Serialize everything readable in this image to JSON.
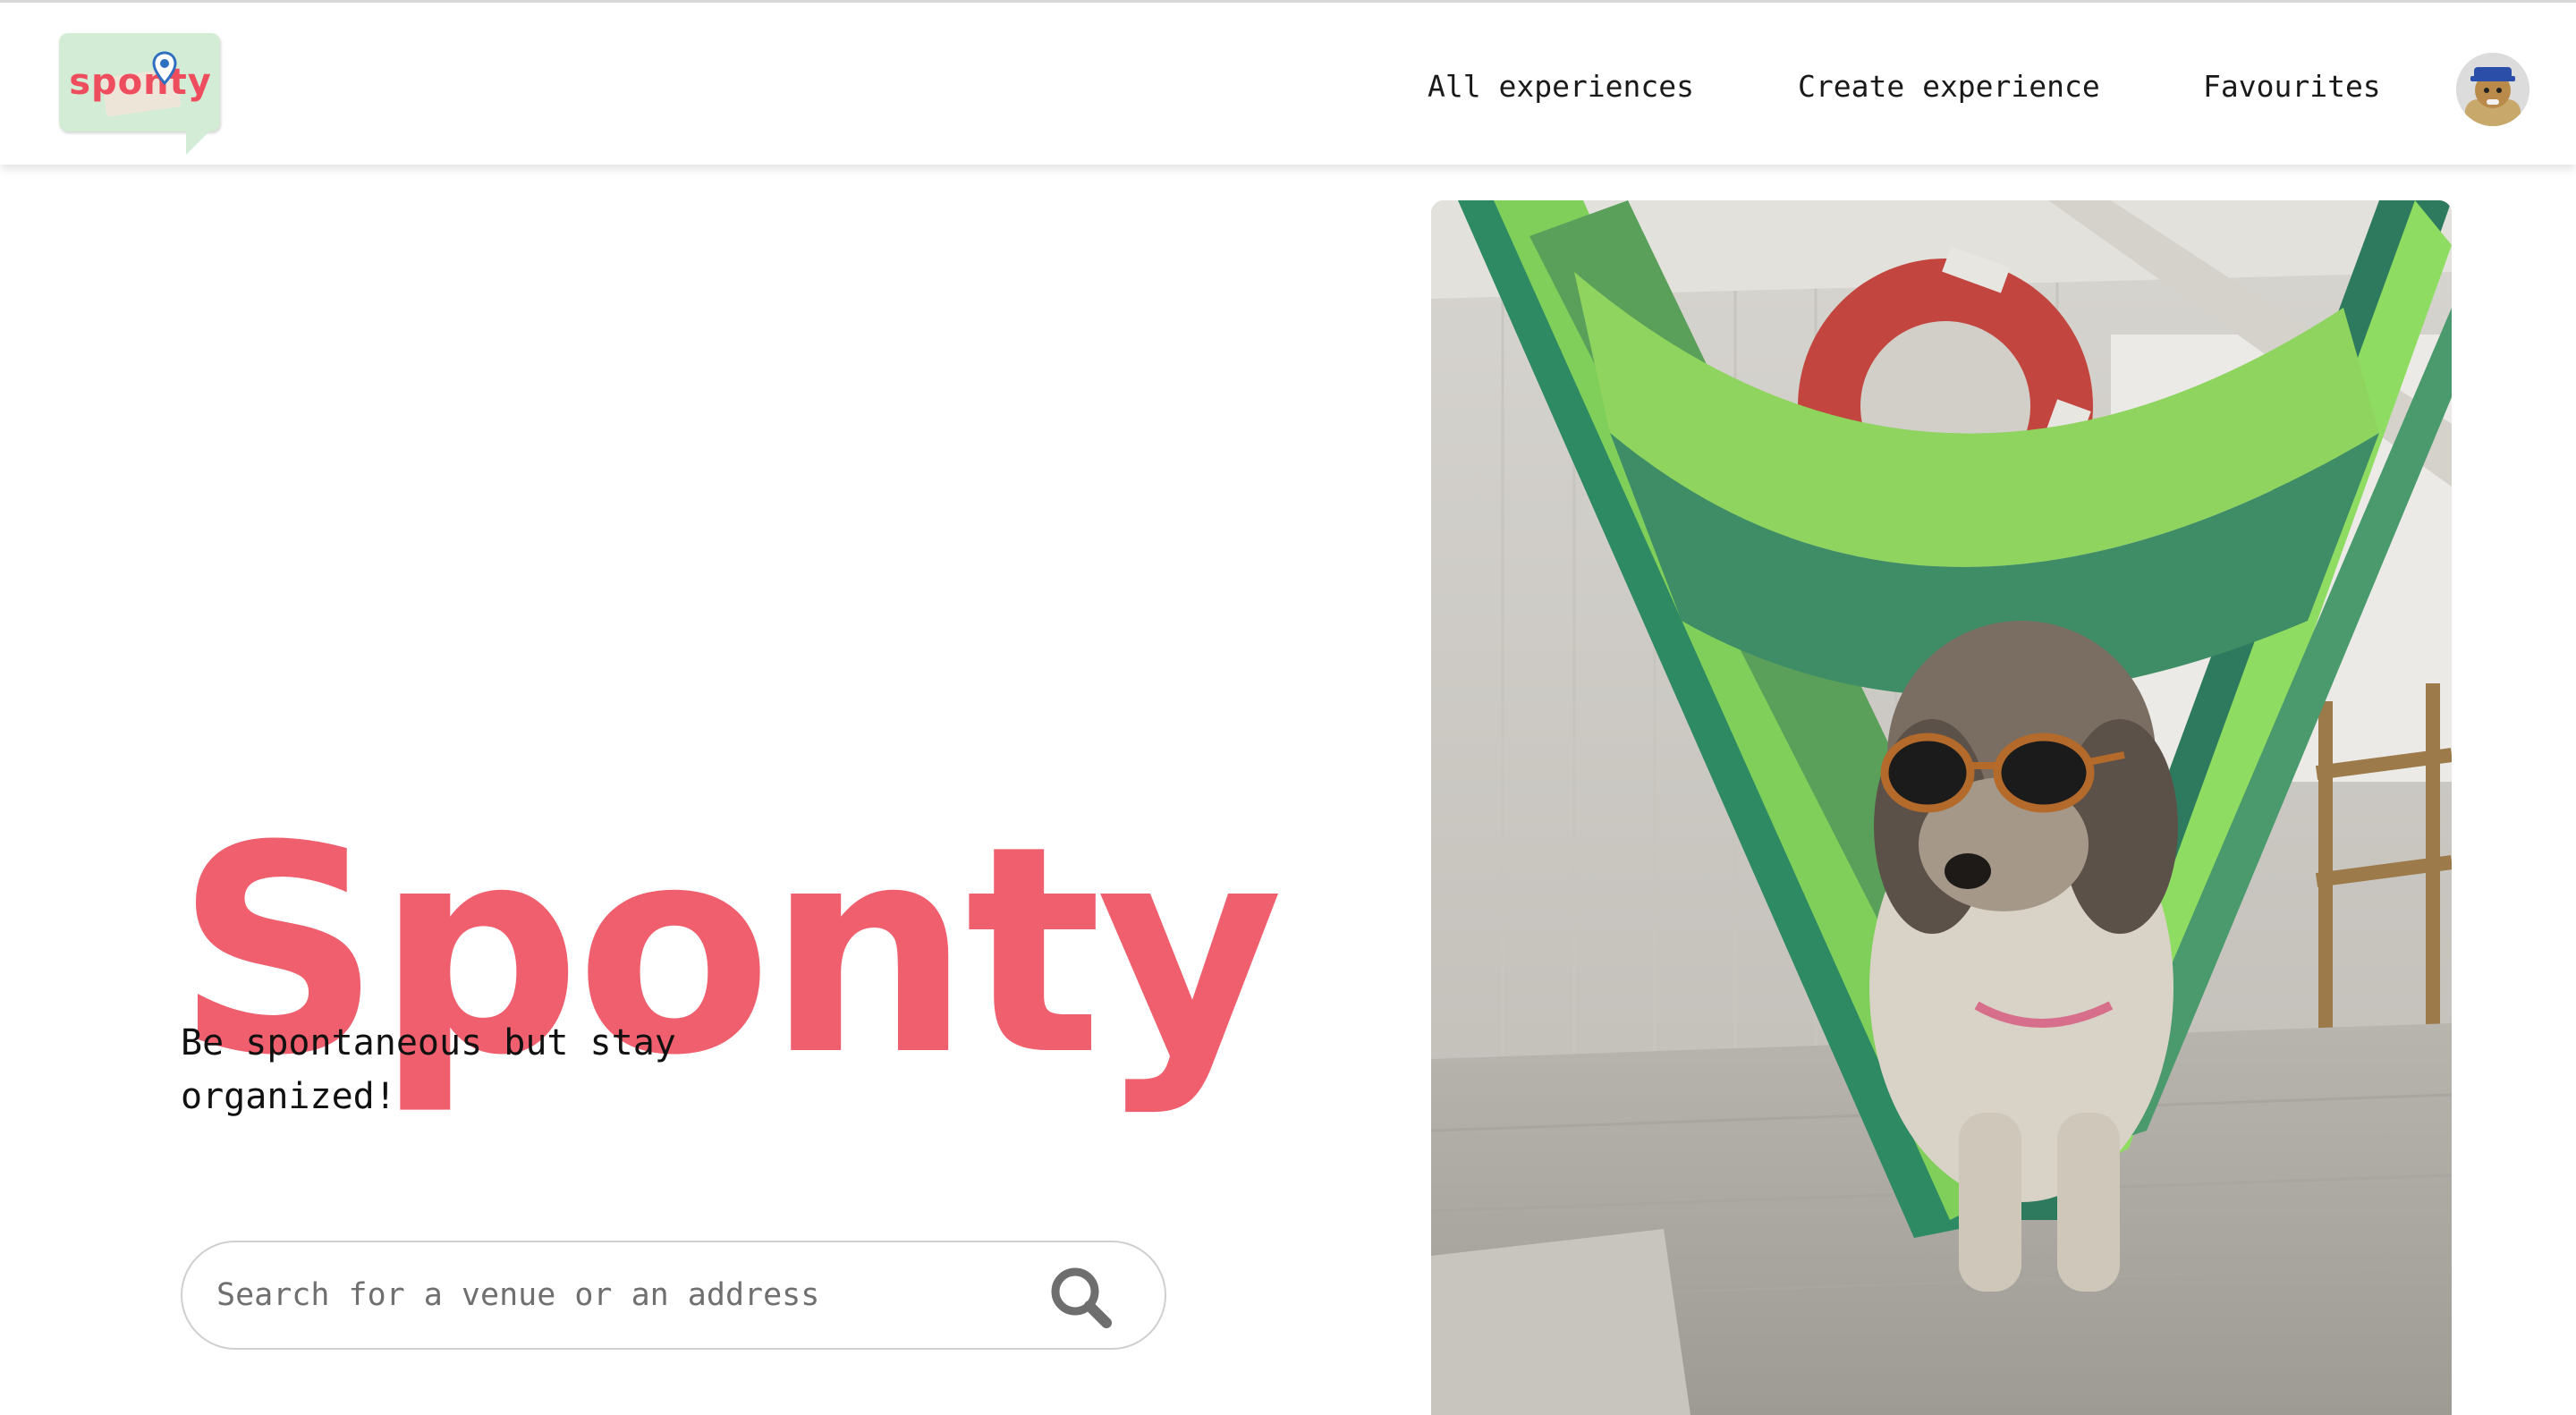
{
  "brand": {
    "logo_text": "sponty",
    "accent_color": "#f05f6e",
    "logo_bg_color": "#d3ecd6"
  },
  "nav": {
    "items": [
      {
        "label": "All experiences"
      },
      {
        "label": "Create experience"
      },
      {
        "label": "Favourites"
      }
    ],
    "avatar_icon": "user-avatar"
  },
  "hero": {
    "title": "Sponty",
    "tagline": "Be spontaneous but stay organized!",
    "search": {
      "placeholder": "Search for a venue or an address",
      "value": "",
      "icon": "search-icon"
    },
    "image_icon": "dog-in-hammock-photo"
  }
}
